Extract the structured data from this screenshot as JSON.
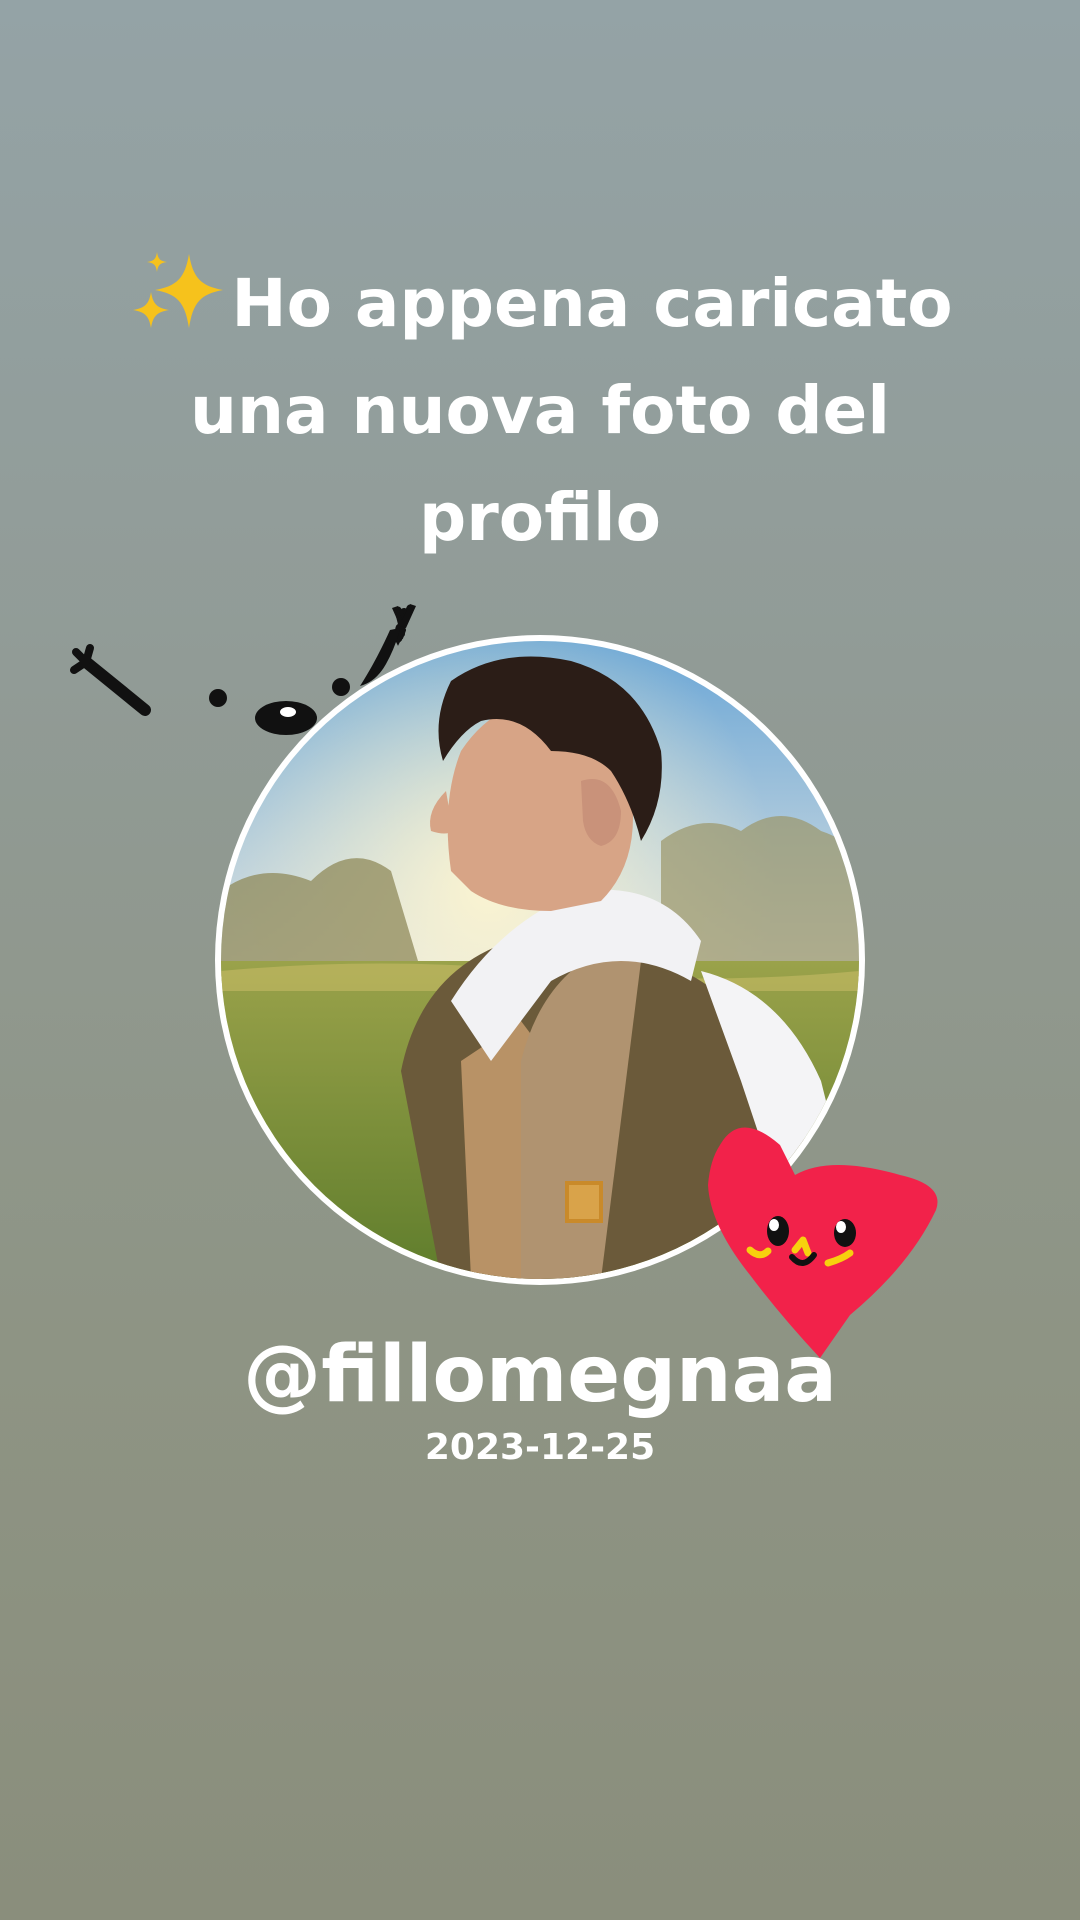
{
  "headline": {
    "emoji": "✨",
    "emoji_icon": "sparkles-icon",
    "line1": "Ho appena caricato",
    "line2": "una nuova foto del",
    "line3": "profilo"
  },
  "profile": {
    "username": "@fillomegnaa",
    "date": "2023-12-25"
  },
  "stickers": {
    "doodle": "waving-face-doodle-icon",
    "heart": "smiling-heart-icon"
  },
  "colors": {
    "text": "#ffffff",
    "heart": "#f2224a",
    "avatar_border": "#ffffff"
  }
}
